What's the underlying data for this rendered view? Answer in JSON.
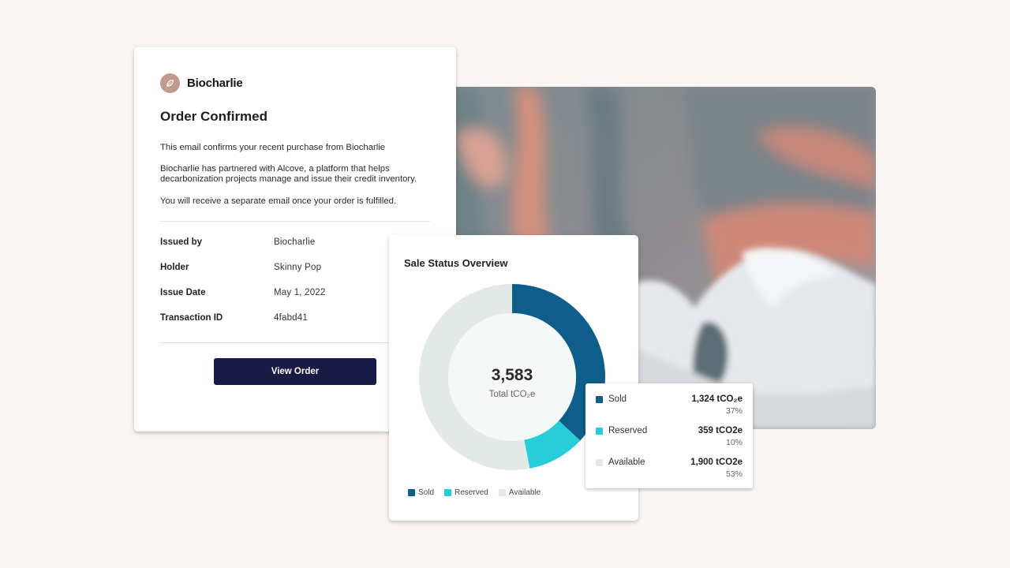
{
  "email": {
    "brand_name": "Biocharlie",
    "title": "Order Confirmed",
    "paragraphs": [
      "This email confirms your recent purchase from Biocharlie",
      "Biocharlie has partnered with Alcove, a platform that helps decarbonization projects manage and issue their credit inventory.",
      "You will receive a separate email once your order is fulfilled."
    ],
    "details": [
      {
        "label": "Issued by",
        "value": "Biocharlie"
      },
      {
        "label": "Holder",
        "value": "Skinny Pop"
      },
      {
        "label": "Issue Date",
        "value": "May 1, 2022"
      },
      {
        "label": "Transaction ID",
        "value": "4fabd41"
      }
    ],
    "button_label": "View Order",
    "logo_icon": "leaf-icon"
  },
  "sale_status": {
    "title": "Sale Status Overview",
    "total_value": "3,583",
    "total_label": "Total tCO₂e",
    "legend": [
      "Sold",
      "Reserved",
      "Available"
    ],
    "breakdown": [
      {
        "label": "Sold",
        "value": "1,324 tCO₂e",
        "percent": "37%"
      },
      {
        "label": "Reserved",
        "value": "359 tCO2e",
        "percent": "10%"
      },
      {
        "label": "Available",
        "value": "1,900 tCO2e",
        "percent": "53%"
      }
    ]
  },
  "chart_data": {
    "type": "pie",
    "categories": [
      "Sold",
      "Reserved",
      "Available"
    ],
    "values": [
      1324,
      359,
      1900
    ],
    "colors": [
      "#0d5e8a",
      "#27cdd9",
      "#e2e9e7"
    ],
    "title": "Sale Status Overview"
  }
}
